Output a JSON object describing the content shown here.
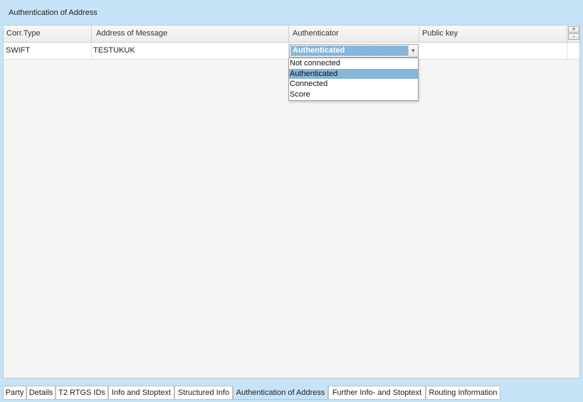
{
  "panel": {
    "title": "Authentication of Address"
  },
  "table": {
    "columns": [
      "Corr.Type",
      "Address of Message",
      "Authenticator",
      "Public key"
    ],
    "add_button": "+",
    "remove_button": "-",
    "rows": [
      {
        "corr_type": "SWIFT",
        "address": "TESTUKUK",
        "authenticator": "Authenticated",
        "public_key": ""
      }
    ]
  },
  "authenticator_dropdown": {
    "selected": "Authenticated",
    "options": [
      "Not connected",
      "Authenticated",
      "Connected",
      "Score"
    ],
    "arrow_icon": "triangle-down-icon"
  },
  "tabs": [
    "Party",
    "Details",
    "T2 RTGS IDs",
    "Info and Stoptext",
    "Structured Info",
    "Authentication of Address",
    "Further Info- and Stoptext",
    "Routing Information"
  ],
  "active_tab": "Authentication of Address",
  "colors": {
    "background": "#c6e3f7",
    "selection": "#86b6d9",
    "grid_background": "#f5f5f5"
  }
}
